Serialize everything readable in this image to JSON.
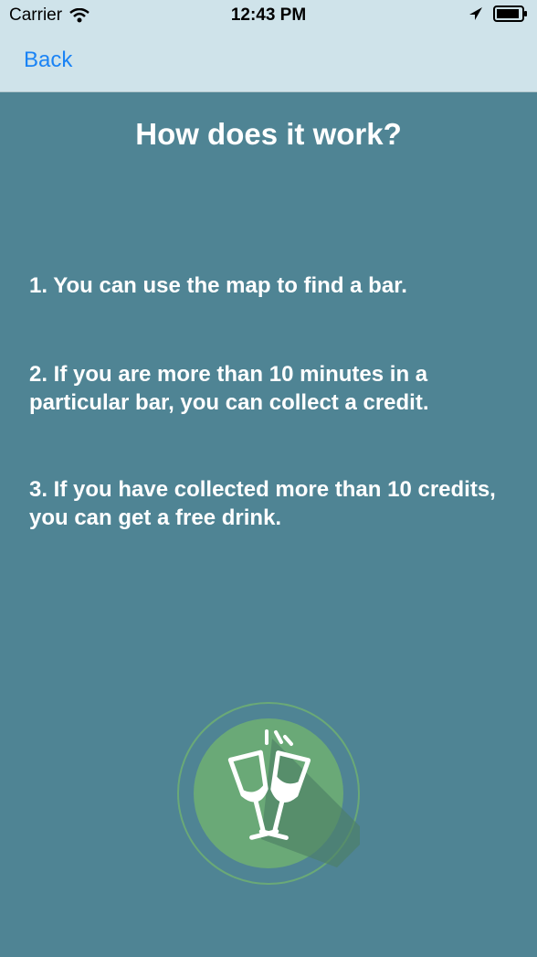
{
  "status_bar": {
    "carrier": "Carrier",
    "time": "12:43 PM"
  },
  "nav": {
    "back_label": "Back"
  },
  "main": {
    "title": "How does it work?",
    "steps": [
      "1. You can use the map to find a bar.",
      "2. If you are more than 10 minutes in a particular bar, you can collect a credit.",
      "3. If you have collected more than 10 credits, you can get a free drink."
    ]
  },
  "icons": {
    "logo": "champagne-glasses-icon"
  },
  "colors": {
    "background": "#4f8494",
    "nav_background": "#cfe3ea",
    "accent": "#1a83f5",
    "logo_green": "#6aa977"
  }
}
